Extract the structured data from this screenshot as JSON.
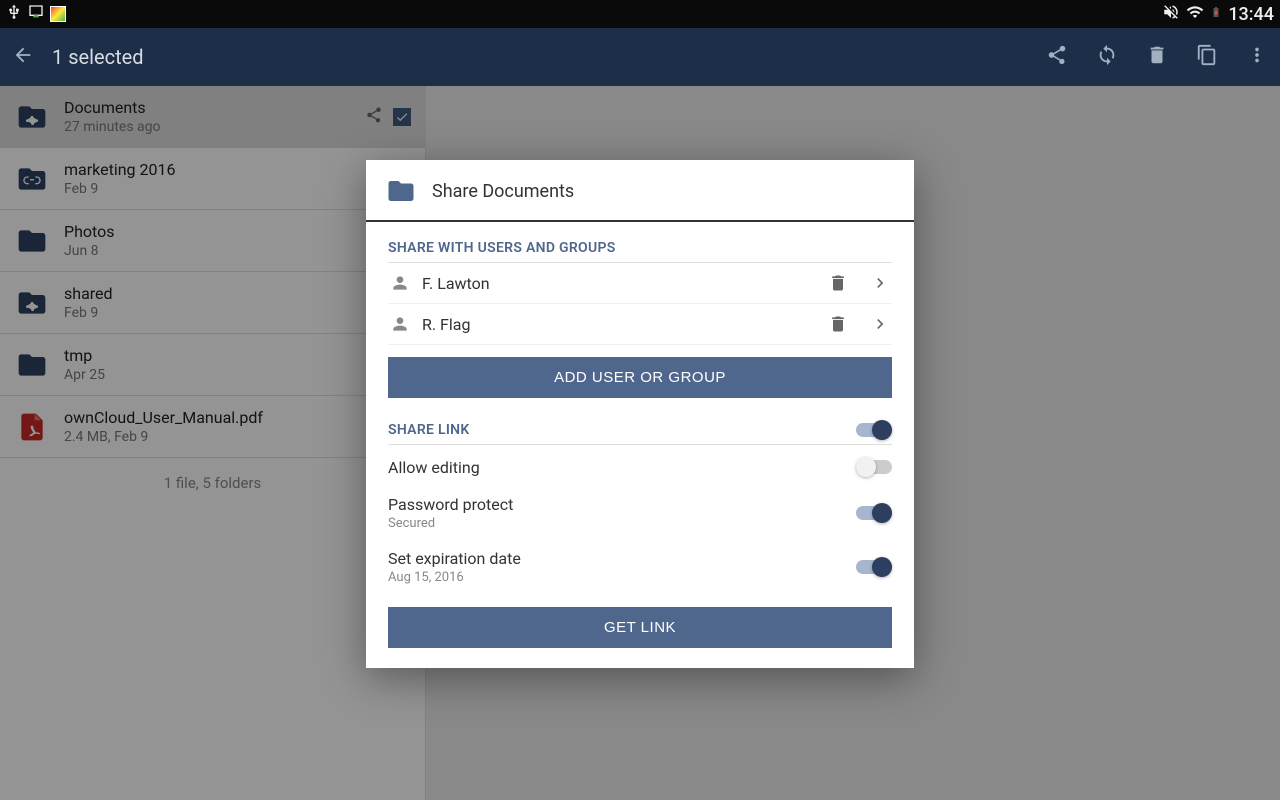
{
  "statusBar": {
    "time": "13:44"
  },
  "appBar": {
    "title": "1 selected"
  },
  "files": {
    "summary": "1 file, 5 folders",
    "items": [
      {
        "name": "Documents",
        "meta": "27 minutes ago",
        "type": "share-folder",
        "selected": true,
        "shared": true
      },
      {
        "name": "marketing 2016",
        "meta": "Feb 9",
        "type": "link-folder"
      },
      {
        "name": "Photos",
        "meta": "Jun 8",
        "type": "folder"
      },
      {
        "name": "shared",
        "meta": "Feb 9",
        "type": "share-folder"
      },
      {
        "name": "tmp",
        "meta": "Apr 25",
        "type": "folder"
      },
      {
        "name": "ownCloud_User_Manual.pdf",
        "meta": "2.4 MB, Feb 9",
        "type": "pdf"
      }
    ]
  },
  "dialog": {
    "title": "Share Documents",
    "shareUsersLabel": "SHARE WITH USERS AND GROUPS",
    "users": [
      {
        "name": "F. Lawton"
      },
      {
        "name": "R. Flag"
      }
    ],
    "addUserBtn": "ADD USER OR GROUP",
    "shareLinkLabel": "SHARE LINK",
    "shareLinkOn": true,
    "options": {
      "allowEditing": {
        "label": "Allow editing",
        "on": false
      },
      "passwordProtect": {
        "label": "Password protect",
        "sub": "Secured",
        "on": true
      },
      "expiration": {
        "label": "Set expiration date",
        "sub": "Aug 15, 2016",
        "on": true
      }
    },
    "getLinkBtn": "GET LINK"
  }
}
